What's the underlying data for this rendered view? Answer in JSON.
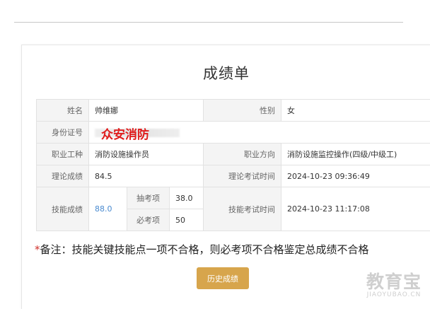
{
  "page": {
    "title": "成绩单"
  },
  "table": {
    "name_label": "姓名",
    "name_value": "帅维娜",
    "gender_label": "性别",
    "gender_value": "女",
    "id_label": "身份证号",
    "job_label": "职业工种",
    "job_value": "消防设施操作员",
    "direction_label": "职业方向",
    "direction_value": "消防设施监控操作(四级/中级工)",
    "theory_label": "理论成绩",
    "theory_value": "84.5",
    "theory_time_label": "理论考试时间",
    "theory_time_value": "2024-10-23 09:36:49",
    "skill_label": "技能成绩",
    "skill_value": "88.0",
    "sample_label": "抽考项",
    "sample_value": "38.0",
    "required_label": "必考项",
    "required_value": "50",
    "skill_time_label": "技能考试时间",
    "skill_time_value": "2024-10-23 11:17:08"
  },
  "watermark_overlay": "众安消防",
  "note": {
    "star": "*",
    "text": "备注：技能关键技能点一项不合格，则必考项不合格鉴定总成绩不合格"
  },
  "buttons": {
    "history": "历史成绩"
  },
  "logo": {
    "main": "教育宝",
    "sub": "JIAOYUBAO.CN"
  },
  "colors": {
    "button": "#d7a54c",
    "link_value": "#4a8bd0",
    "star": "#d0302b",
    "overlay_text": "#e01c1c"
  }
}
